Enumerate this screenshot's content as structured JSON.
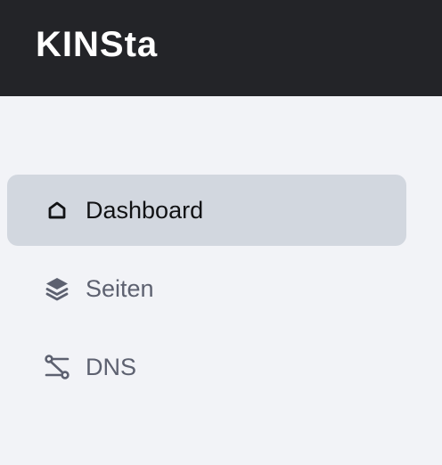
{
  "brand": {
    "logo_text": "KINSta"
  },
  "sidebar": {
    "items": [
      {
        "label": "Dashboard",
        "icon": "home-icon",
        "active": true
      },
      {
        "label": "Seiten",
        "icon": "layers-icon",
        "active": false
      },
      {
        "label": "DNS",
        "icon": "route-icon",
        "active": false
      }
    ]
  },
  "colors": {
    "topbar_bg": "#232428",
    "page_bg": "#f2f3f7",
    "active_item_bg": "#d2d7df",
    "active_text": "#111214",
    "inactive_text": "#5d6170"
  }
}
